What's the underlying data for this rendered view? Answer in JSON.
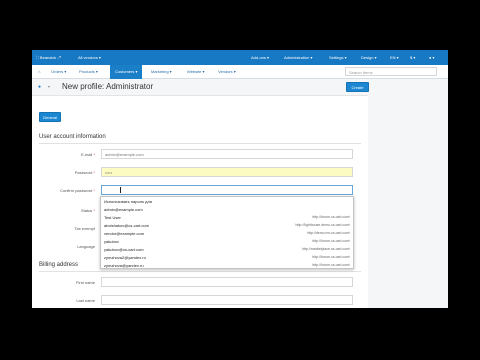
{
  "topbar": {
    "store": "Bearwick",
    "vendors": "All vendors",
    "addons": "Add-ons",
    "administration": "Administration",
    "settings": "Settings",
    "design": "Design",
    "language": "EN",
    "currency": "$"
  },
  "nav": {
    "orders": "Orders",
    "products": "Products",
    "customers": "Customers",
    "marketing": "Marketing",
    "website": "Website",
    "vendors": "Vendors",
    "search_placeholder": "Search Items"
  },
  "header": {
    "title": "New profile: Administrator",
    "create_label": "Create"
  },
  "tabs": {
    "general": "General"
  },
  "account": {
    "section_title": "User account information",
    "email_label": "E-mail",
    "email_value": "admin@example.com",
    "password_label": "Password",
    "password_value": "•••••",
    "confirm_label": "Confirm password",
    "status_label": "Status",
    "tax_label": "Tax exempt",
    "language_label": "Language",
    "required_mark": "*"
  },
  "billing": {
    "section_title": "Billing address",
    "first_name_label": "First name",
    "last_name_label": "Last name"
  },
  "autocomplete": [
    {
      "user": "Использовать пароль для",
      "site": ""
    },
    {
      "user": "admin@example.com",
      "site": ""
    },
    {
      "user": "Test User",
      "site": "http://forum.cs-cart.com/"
    },
    {
      "user": "abolshakov@cs-cart.com",
      "site": "http://lighthouse.demo.cs-cart.com/"
    },
    {
      "user": "vendor@example.com",
      "site": "http://demo.mv.cs-cart.com/"
    },
    {
      "user": "yakubov",
      "site": "http://forum.cs-cart.com/"
    },
    {
      "user": "yakubov@cs-cart.com",
      "site": "http://marketplace.cs-cart.com/"
    },
    {
      "user": "zymzhova2@yandex.ru",
      "site": "http://forum.cs-cart.com/"
    },
    {
      "user": "zymzhova@yandex.ru",
      "site": "http://forum.cs-cart.com/"
    }
  ]
}
